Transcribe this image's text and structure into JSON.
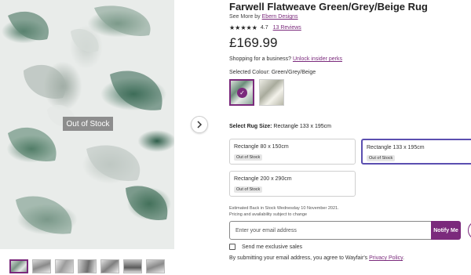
{
  "product": {
    "title": "Farwell Flatweave Green/Grey/Beige Rug",
    "see_more_prefix": "See More by",
    "brand": "Ebern Designs",
    "stars": "★★★★★",
    "rating": "4.7",
    "reviews": "13 Reviews",
    "price": "£169.99"
  },
  "gallery": {
    "oos_badge": "Out of Stock",
    "thumbnail_count": 7
  },
  "business": {
    "prefix": "Shopping for a business?",
    "link": "Unlock insider perks"
  },
  "colour": {
    "label": "Selected Colour: Green/Grey/Beige",
    "check": "✓"
  },
  "rug_size": {
    "label": "Select Rug Size:",
    "selected_value": "Rectangle 133 x 195cm",
    "options": [
      {
        "name": "Rectangle 80 x 150cm",
        "status": "Out of Stock"
      },
      {
        "name": "Rectangle 133 x 195cm",
        "status": "Out of Stock"
      },
      {
        "name": "Rectangle 200 x 290cm",
        "status": "Out of Stock"
      }
    ]
  },
  "stock_info": {
    "line1": "Estimated Back in Stock Wednesday 10 November 2021.",
    "line2": "Pricing and availability subject to change"
  },
  "notify": {
    "placeholder": "Enter your email address",
    "button": "Notify Me"
  },
  "exclusive": {
    "label": "Send me exclusive sales"
  },
  "terms": {
    "text": "By submitting your email address, you agree to Wayfair's",
    "link": "Privacy Policy",
    "suffix": "."
  },
  "colors": {
    "accent": "#7b2a7c",
    "selected_border": "#5b4fb0"
  },
  "icons": {
    "next": "chevron-right-icon",
    "check": "check-icon"
  }
}
